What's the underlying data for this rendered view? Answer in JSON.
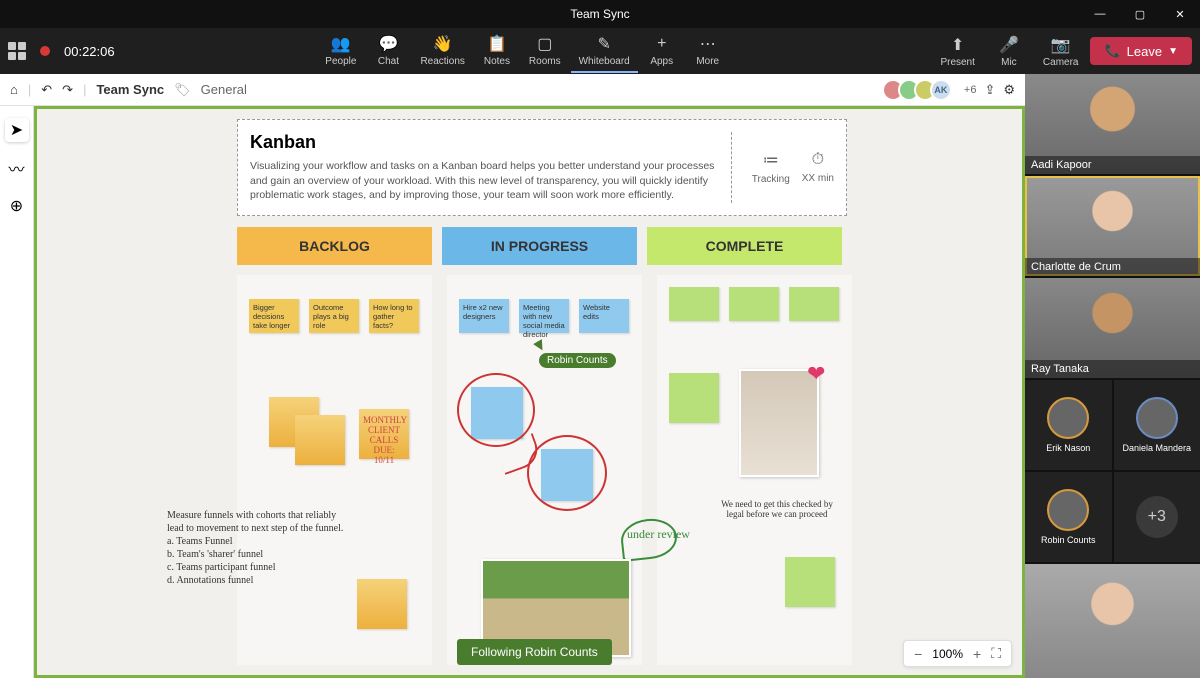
{
  "window": {
    "title": "Team Sync"
  },
  "toolbar": {
    "rec_time": "00:22:06",
    "items": [
      {
        "label": "People",
        "icon": "👥"
      },
      {
        "label": "Chat",
        "icon": "💬"
      },
      {
        "label": "Reactions",
        "icon": "👋"
      },
      {
        "label": "Notes",
        "icon": "📋"
      },
      {
        "label": "Rooms",
        "icon": "▢"
      },
      {
        "label": "Whiteboard",
        "icon": "✎",
        "active": true
      },
      {
        "label": "Apps",
        "icon": "+"
      },
      {
        "label": "More",
        "icon": "⋯"
      }
    ],
    "right": [
      {
        "label": "Camera",
        "icon": "📷"
      },
      {
        "label": "Mic",
        "icon": "🎤"
      },
      {
        "label": "Present",
        "icon": "⬆"
      }
    ],
    "leave": "Leave"
  },
  "wb_header": {
    "breadcrumb": "Team Sync",
    "tag": "General",
    "more_count": "+6",
    "avatars": [
      "",
      "",
      "",
      "AK"
    ]
  },
  "info": {
    "title": "Kanban",
    "body": "Visualizing your workflow and tasks on a Kanban board helps you better understand your processes and gain an overview of your workload. With this new level of transparency, you will quickly identify problematic work stages, and by improving those, your team will soon work more efficiently.",
    "chips": [
      {
        "icon": "≔",
        "label": "Tracking"
      },
      {
        "icon": "⏱",
        "label": "XX min"
      }
    ]
  },
  "columns": {
    "backlog": "BACKLOG",
    "progress": "IN PROGRESS",
    "complete": "COMPLETE"
  },
  "notes": {
    "backlog": [
      "Bigger decisions take longer",
      "Outcome plays a big role",
      "How long to gather facts?"
    ],
    "monthly": "MONTHLY CLIENT CALLS\nDUE: 10/11",
    "progress": [
      "Hire x2 new designers",
      "Meeting with new social media director",
      "Website edits"
    ]
  },
  "handwriting": {
    "funnel": "Measure funnels with cohorts that reliably lead to movement to next step of the funnel.\n   a. Teams Funnel\n   b. Team's 'sharer' funnel\n   c. Teams participant funnel\n   d. Annotations funnel",
    "under_review": "under review",
    "legal": "We need to get this checked by legal before we can proceed"
  },
  "cursor": {
    "user": "Robin Counts"
  },
  "follow_banner": "Following Robin Counts",
  "zoom": {
    "value": "100%"
  },
  "participants": {
    "big": [
      {
        "name": "Aadi Kapoor"
      },
      {
        "name": "Charlotte de Crum",
        "highlight": true
      },
      {
        "name": "Ray Tanaka"
      }
    ],
    "small": [
      {
        "name": "Erik Nason"
      },
      {
        "name": "Daniela Mandera"
      },
      {
        "name": "Robin Counts"
      }
    ],
    "overflow": "+3"
  }
}
